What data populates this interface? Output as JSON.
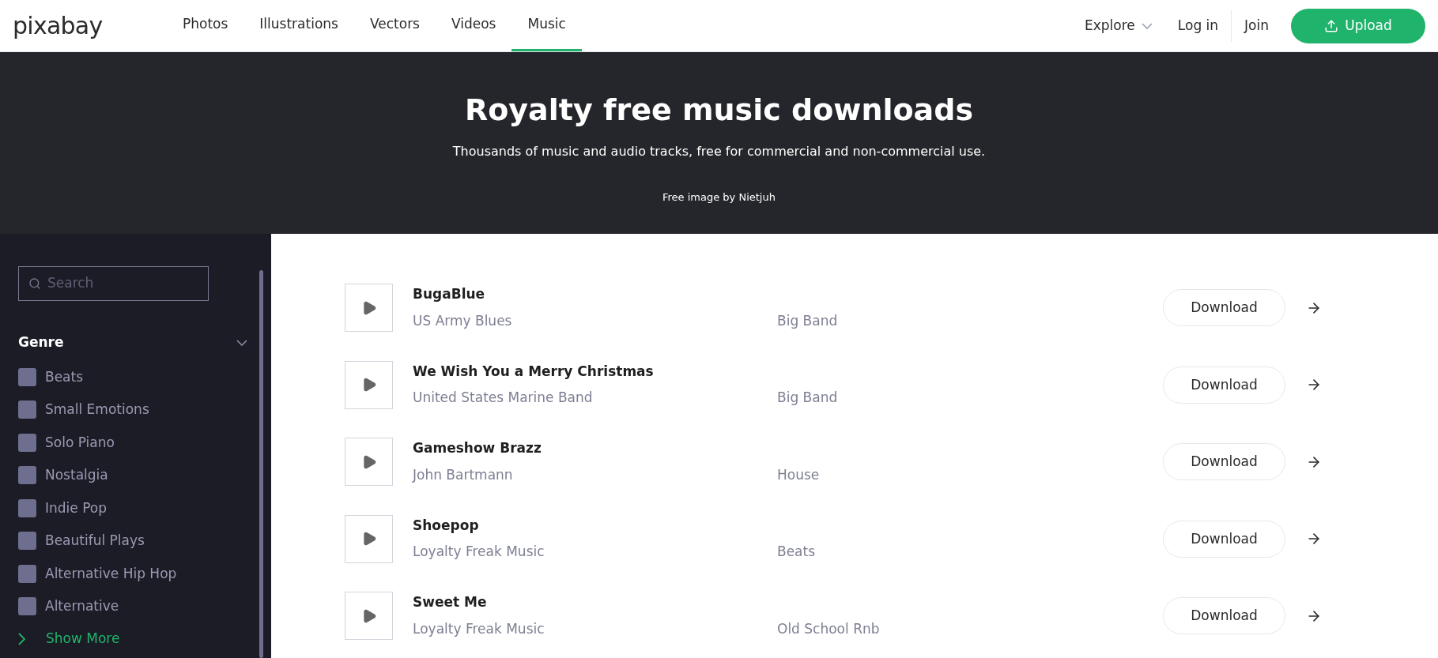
{
  "header": {
    "logo": "pixabay",
    "nav": [
      {
        "label": "Photos",
        "selected": false
      },
      {
        "label": "Illustrations",
        "selected": false
      },
      {
        "label": "Vectors",
        "selected": false
      },
      {
        "label": "Videos",
        "selected": false
      },
      {
        "label": "Music",
        "selected": true
      }
    ],
    "explore": "Explore",
    "login": "Log in",
    "join": "Join",
    "upload": "Upload"
  },
  "hero": {
    "title": "Royalty free music downloads",
    "subtitle": "Thousands of music and audio tracks, free for commercial and non-commercial use.",
    "credit": "Free image by Nietjuh"
  },
  "sidebar": {
    "search": {
      "placeholder": "Search"
    },
    "genre": {
      "title": "Genre",
      "expanded": true,
      "items": [
        {
          "label": "Beats",
          "checked": false
        },
        {
          "label": "Small Emotions",
          "checked": false
        },
        {
          "label": "Solo Piano",
          "checked": false
        },
        {
          "label": "Nostalgia",
          "checked": false
        },
        {
          "label": "Indie Pop",
          "checked": false
        },
        {
          "label": "Beautiful Plays",
          "checked": false
        },
        {
          "label": "Alternative Hip Hop",
          "checked": false
        },
        {
          "label": "Alternative",
          "checked": false
        }
      ],
      "show_more": "Show More"
    }
  },
  "tracks": [
    {
      "title": "BugaBlue",
      "artist": "US Army Blues",
      "genre": "Big Band",
      "download": "Download"
    },
    {
      "title": "We Wish You a Merry Christmas",
      "artist": "United States Marine Band",
      "genre": "Big Band",
      "download": "Download"
    },
    {
      "title": "Gameshow Brazz",
      "artist": "John Bartmann",
      "genre": "House",
      "download": "Download"
    },
    {
      "title": "Shoepop",
      "artist": "Loyalty Freak Music",
      "genre": "Beats",
      "download": "Download"
    },
    {
      "title": "Sweet Me",
      "artist": "Loyalty Freak Music",
      "genre": "Old School Rnb",
      "download": "Download"
    }
  ]
}
